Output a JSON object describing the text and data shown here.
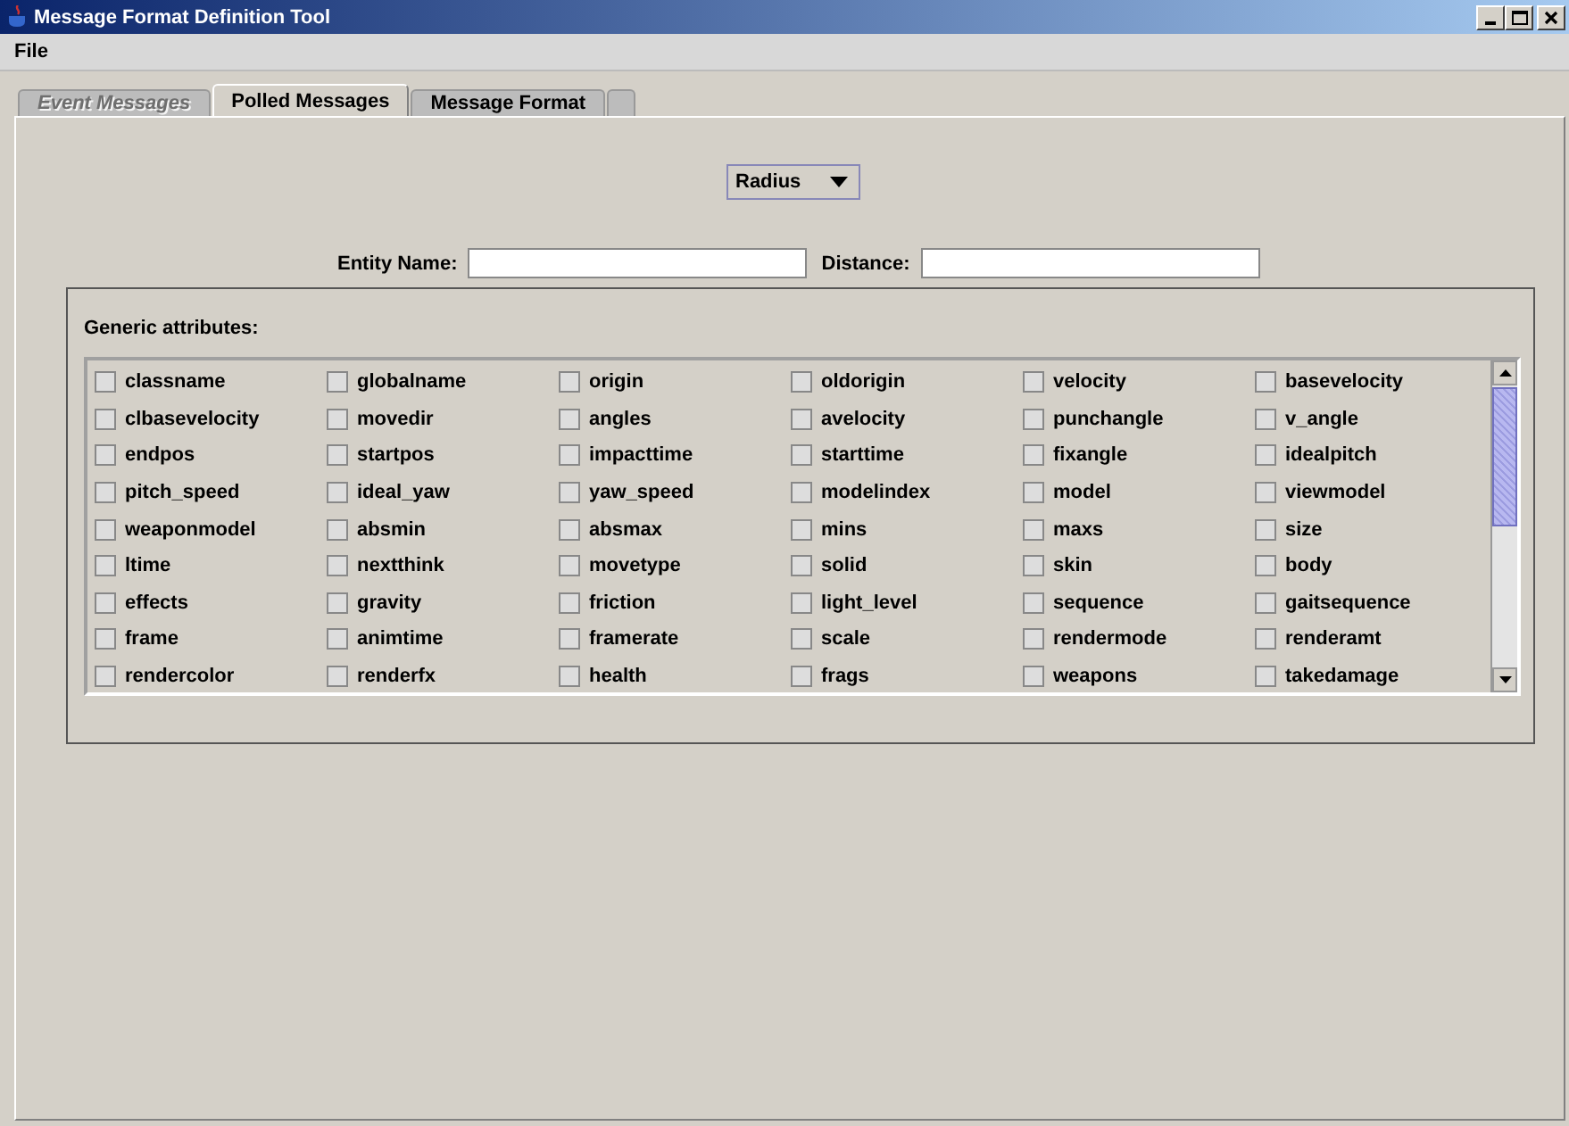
{
  "window": {
    "title": "Message Format Definition Tool"
  },
  "menu": [
    "File"
  ],
  "tabs": [
    {
      "label": "Event Messages",
      "selected": false,
      "disabled": true
    },
    {
      "label": "Polled Messages",
      "selected": true,
      "disabled": false
    },
    {
      "label": "Message Format",
      "selected": false,
      "disabled": false
    },
    {
      "selected": false,
      "kind": "stub"
    }
  ],
  "mode_dropdown": {
    "value": "Radius"
  },
  "fields": [
    {
      "label": "Entity Name:"
    },
    {
      "label": "Distance:"
    }
  ],
  "group": {
    "title": "Generic attributes:"
  },
  "attributes": [
    {
      "label": "classname",
      "checked": false
    },
    {
      "label": "globalname",
      "checked": false
    },
    {
      "label": "origin",
      "checked": false
    },
    {
      "label": "oldorigin",
      "checked": false
    },
    {
      "label": "velocity",
      "checked": false
    },
    {
      "label": "basevelocity",
      "checked": false
    },
    {
      "label": "clbasevelocity",
      "checked": false
    },
    {
      "label": "movedir",
      "checked": false
    },
    {
      "label": "angles",
      "checked": false
    },
    {
      "label": "avelocity",
      "checked": false
    },
    {
      "label": "punchangle",
      "checked": false
    },
    {
      "label": "v_angle",
      "checked": false
    },
    {
      "label": "endpos",
      "checked": false
    },
    {
      "label": "startpos",
      "checked": false
    },
    {
      "label": "impacttime",
      "checked": false
    },
    {
      "label": "starttime",
      "checked": false
    },
    {
      "label": "fixangle",
      "checked": false
    },
    {
      "label": "idealpitch",
      "checked": false
    },
    {
      "label": "pitch_speed",
      "checked": false
    },
    {
      "label": "ideal_yaw",
      "checked": false
    },
    {
      "label": "yaw_speed",
      "checked": false
    },
    {
      "label": "modelindex",
      "checked": false
    },
    {
      "label": "model",
      "checked": false
    },
    {
      "label": "viewmodel",
      "checked": false
    },
    {
      "label": "weaponmodel",
      "checked": false
    },
    {
      "label": "absmin",
      "checked": false
    },
    {
      "label": "absmax",
      "checked": false
    },
    {
      "label": "mins",
      "checked": false
    },
    {
      "label": "maxs",
      "checked": false
    },
    {
      "label": "size",
      "checked": false
    },
    {
      "label": "ltime",
      "checked": false
    },
    {
      "label": "nextthink",
      "checked": false
    },
    {
      "label": "movetype",
      "checked": false
    },
    {
      "label": "solid",
      "checked": false
    },
    {
      "label": "skin",
      "checked": false
    },
    {
      "label": "body",
      "checked": false
    },
    {
      "label": "effects",
      "checked": false
    },
    {
      "label": "gravity",
      "checked": false
    },
    {
      "label": "friction",
      "checked": false
    },
    {
      "label": "light_level",
      "checked": false
    },
    {
      "label": "sequence",
      "checked": false
    },
    {
      "label": "gaitsequence",
      "checked": false
    },
    {
      "label": "frame",
      "checked": false
    },
    {
      "label": "animtime",
      "checked": false
    },
    {
      "label": "framerate",
      "checked": false
    },
    {
      "label": "scale",
      "checked": false
    },
    {
      "label": "rendermode",
      "checked": false
    },
    {
      "label": "renderamt",
      "checked": false
    },
    {
      "label": "rendercolor",
      "checked": false
    },
    {
      "label": "renderfx",
      "checked": false
    },
    {
      "label": "health",
      "checked": false
    },
    {
      "label": "frags",
      "checked": false
    },
    {
      "label": "weapons",
      "checked": false
    },
    {
      "label": "takedamage",
      "checked": false
    }
  ]
}
